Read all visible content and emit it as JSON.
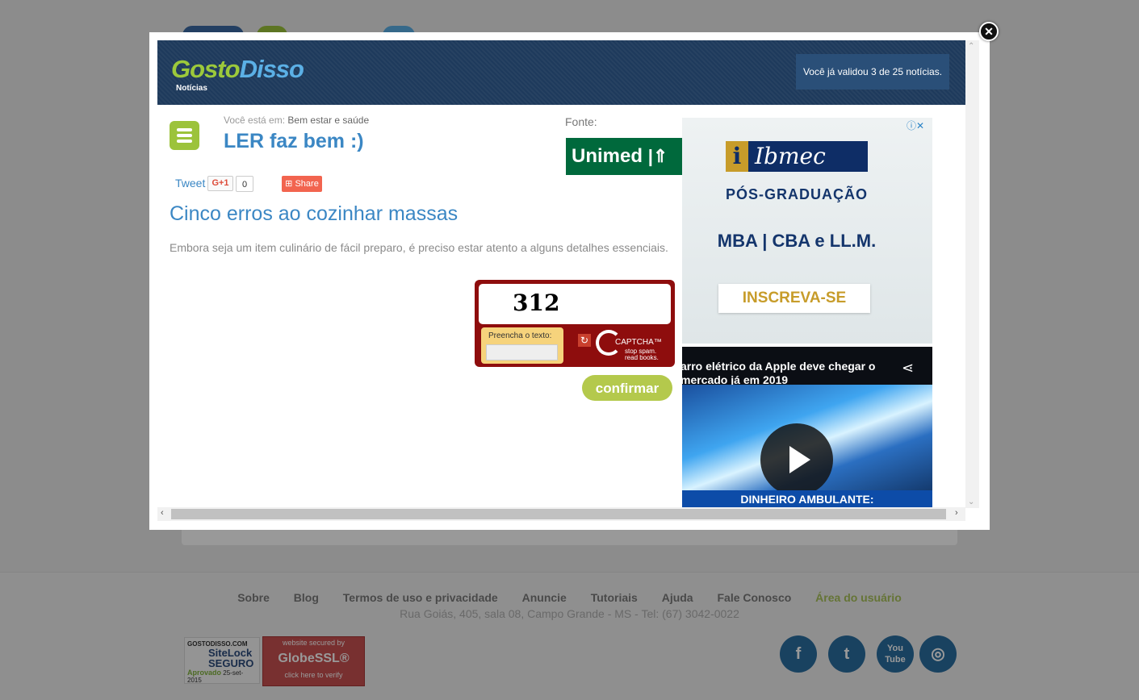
{
  "header": {
    "logo_part1": "Gosto",
    "logo_part2": "Disso",
    "logo_sub": "Notícias",
    "validated": "Você já validou 3 de 25 notícias."
  },
  "breadcrumb": {
    "prefix": "Você está em:",
    "category": "Bem estar e saúde"
  },
  "category_title": "LER faz bem :)",
  "source": {
    "label": "Fonte:",
    "name": "Unimed"
  },
  "social_share": {
    "tweet": "Tweet",
    "gplus": "G+1",
    "gplus_count": "0",
    "share": "Share"
  },
  "article": {
    "title": "Cinco erros ao cozinhar massas",
    "lead": "Embora seja um item culinário de fácil preparo, é preciso estar atento a alguns detalhes essenciais."
  },
  "captcha": {
    "word": "312",
    "field_label": "Preencha o texto:",
    "input_value": "",
    "brand": "CAPTCHA™",
    "slogan1": "stop spam.",
    "slogan2": "read books."
  },
  "confirm_label": "confirmar",
  "ad_ibmec": {
    "logo_i": "i",
    "logo": "Ibmec",
    "line1": "PÓS-GRADUAÇÃO",
    "line2": "MBA | CBA e LL.M.",
    "cta": "INSCREVA-SE"
  },
  "ad_video": {
    "title": "arro elétrico da Apple deve chegar o mercado já em 2019",
    "caption": "DINHEIRO AMBULANTE:"
  },
  "footer": {
    "nav": [
      "Sobre",
      "Blog",
      "Termos de uso e privacidade",
      "Anuncie",
      "Tutoriais",
      "Ajuda",
      "Fale Conosco",
      "Área do usuário"
    ],
    "address": "Rua Goiás, 405, sala 08, Campo Grande - MS - Tel: (67) 3042-0022",
    "sitelock_top": "GOSTODISSO.COM",
    "sitelock_main1": "SiteLock",
    "sitelock_main2": "SEGURO",
    "sitelock_ok": "Aprovado",
    "sitelock_date": "25-set-2015",
    "ssl_top": "website secured by",
    "ssl_main": "GlobeSSL®",
    "ssl_bottom": "click here to verify",
    "social": [
      "f",
      "t",
      "You Tube",
      "◎"
    ]
  },
  "colors": {
    "header_bg": "#1e3a5c",
    "accent_green": "#9cc33b",
    "link_blue": "#3b87c4",
    "captcha_red": "#8e0d0d"
  }
}
